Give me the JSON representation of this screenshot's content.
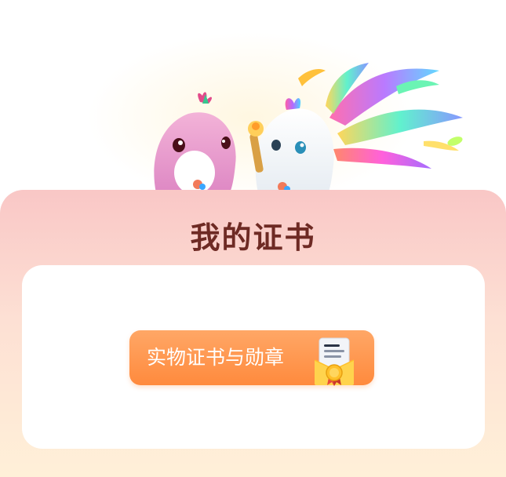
{
  "certificates": {
    "title": "我的证书",
    "button_label": "实物证书与勋章"
  },
  "icons": {
    "mascots": "dolphin-mascots-illustration",
    "certificate": "certificate-medal-icon"
  },
  "colors": {
    "card_top": "#f9c7c6",
    "card_bottom": "#fff0d8",
    "title": "#6e2a24",
    "button": "#ff8a3d",
    "button_text": "#ffffff"
  }
}
